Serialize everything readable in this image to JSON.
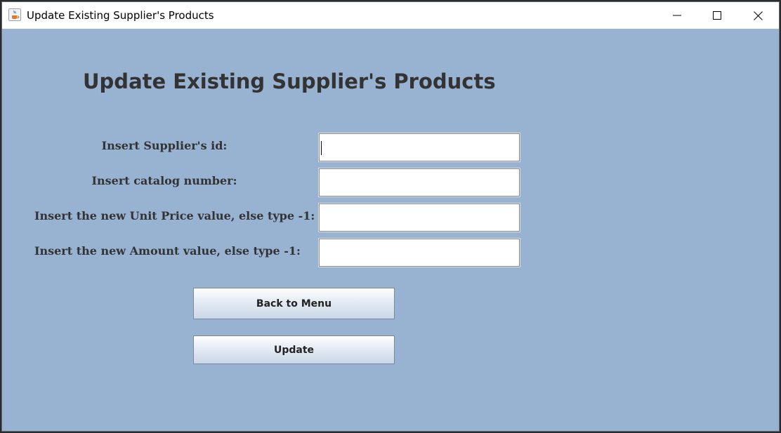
{
  "window": {
    "title": "Update Existing Supplier's Products",
    "app_icon": "java-cup-icon",
    "controls": {
      "minimize": "minimize-icon",
      "maximize": "maximize-icon",
      "close": "close-icon"
    }
  },
  "form": {
    "heading": "Update Existing Supplier's Products",
    "fields": [
      {
        "label": "Insert Supplier's id:",
        "value": "",
        "placeholder": ""
      },
      {
        "label": "Insert catalog number:",
        "value": "",
        "placeholder": ""
      },
      {
        "label": "Insert the new Unit Price value, else type -1:",
        "value": "",
        "placeholder": ""
      },
      {
        "label": "Insert the new Amount value, else type -1:",
        "value": "",
        "placeholder": ""
      }
    ],
    "buttons": {
      "back": "Back to Menu",
      "update": "Update"
    }
  },
  "colors": {
    "background": "#98b2d1",
    "title_text": "#333333",
    "titlebar": "#ffffff"
  }
}
